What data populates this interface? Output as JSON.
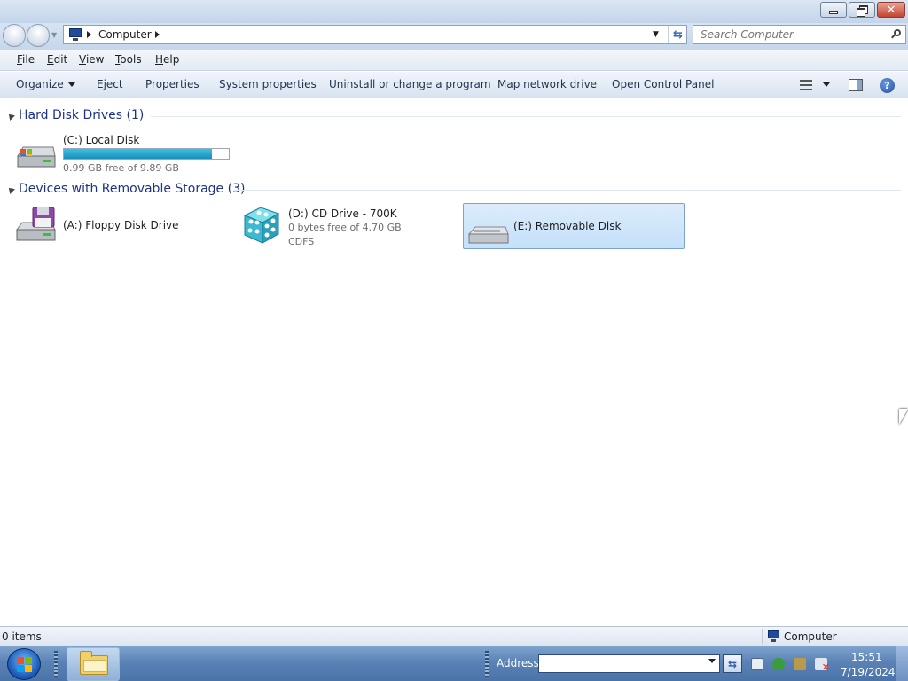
{
  "window": {
    "minimize_icon": "minimize-icon",
    "restore_icon": "restore-icon",
    "close_icon": "close-icon",
    "close_glyph": "✕"
  },
  "nav": {
    "breadcrumb": [
      "Computer"
    ],
    "search_placeholder": "Search Computer",
    "refresh_glyph": "⇆"
  },
  "menu": {
    "items": [
      {
        "first": "F",
        "rest": "ile"
      },
      {
        "first": "E",
        "rest": "dit"
      },
      {
        "first": "V",
        "rest": "iew"
      },
      {
        "first": "T",
        "rest": "ools"
      },
      {
        "first": "H",
        "rest": "elp"
      }
    ]
  },
  "toolbar": {
    "organize": "Organize",
    "eject": "Eject",
    "properties": "Properties",
    "system_properties": "System properties",
    "uninstall": "Uninstall or change a program",
    "map_drive": "Map network drive",
    "control_panel": "Open Control Panel",
    "help_glyph": "?"
  },
  "groups": [
    {
      "title": "Hard Disk Drives (1)",
      "drives": [
        {
          "name": "(C:) Local Disk",
          "usage_fraction": 0.9,
          "free_text": "0.99 GB free of 9.89 GB",
          "icon": "hard-drive-icon"
        }
      ]
    },
    {
      "title": "Devices with Removable Storage (3)",
      "drives": [
        {
          "name": "(A:) Floppy Disk Drive",
          "icon": "floppy-drive-icon"
        },
        {
          "name": "(D:) CD Drive - 700K",
          "free_text": "0 bytes free of 4.70 GB",
          "filesystem": "CDFS",
          "icon": "cd-drive-icon"
        },
        {
          "name": "(E:) Removable Disk",
          "icon": "removable-disk-icon",
          "selected": true
        }
      ]
    }
  ],
  "status": {
    "count": "0 items",
    "location": "Computer"
  },
  "taskbar": {
    "address_label": "Address",
    "go_glyph": "⇆",
    "time": "15:51",
    "date": "7/19/2024"
  },
  "colors": {
    "selection_bg": "#cce4fb",
    "group_header": "#1e3287",
    "usage_bar": "#26a0da"
  }
}
